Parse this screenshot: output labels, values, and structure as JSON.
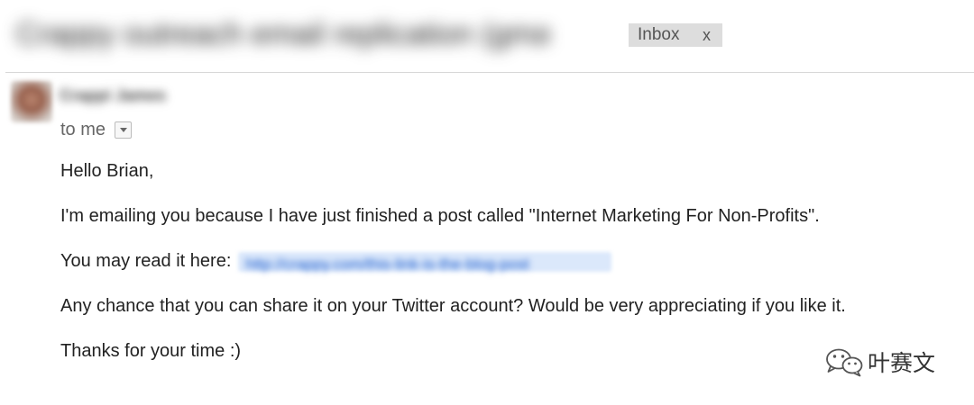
{
  "email": {
    "subject": "Crappy outreach email replication (gmail)",
    "label": {
      "text": "Inbox",
      "remove_symbol": "x"
    },
    "sender": {
      "name": "Crappi James"
    },
    "recipient_line": "to me",
    "body": {
      "greeting": "Hello Brian,",
      "line1": "I'm emailing you because I have just finished a post called \"Internet Marketing For Non-Profits\".",
      "line2_prefix": "You may read it here:",
      "line2_link": "http://crappy.com/this-link-is-the-blog-post",
      "line3": "Any chance that you can share it on your Twitter account? Would be very appreciating if you like it.",
      "signoff": "Thanks for your time :)"
    }
  },
  "watermark": {
    "text": "叶赛文",
    "icon": "wechat-icon"
  }
}
